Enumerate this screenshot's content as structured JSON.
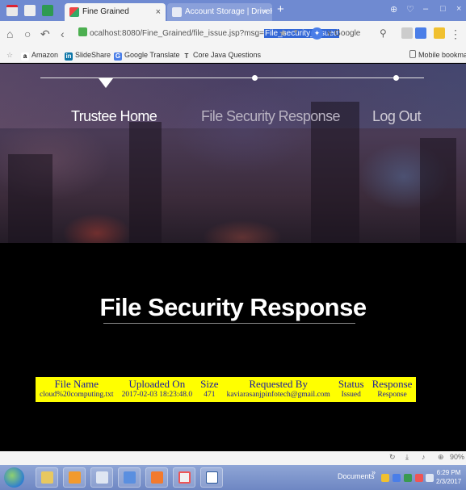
{
  "browser": {
    "tabs": [
      {
        "title": "Fine Grained",
        "close": "×"
      },
      {
        "title": "Account Storage | DriveHQ",
        "close": "×"
      }
    ],
    "new_tab": "+",
    "window_controls": [
      "⊕",
      "♡",
      "–",
      "□",
      "×"
    ],
    "url_prefix": "ocalhost:8080/Fine_Grained/file_issue.jsp?msg=",
    "url_highlight": "File_security_issued",
    "search_engine": "Google",
    "bookmarks": [
      "Amazon",
      "SlideShare",
      "Google Translate",
      "Core Java Questions"
    ],
    "mobile_bookmarks": "Mobile bookmarks",
    "colors": {
      "tabstrip": "#6f8ad1",
      "url_highlight": "#3367d6"
    }
  },
  "site_nav": {
    "items": [
      "Trustee Home",
      "File Security Response",
      "Log Out"
    ]
  },
  "page": {
    "title": "File Security Response"
  },
  "table": {
    "headers": [
      "File Name",
      "Uploaded On",
      "Size",
      "Requested By",
      "Status",
      "Response"
    ],
    "rows": [
      [
        "cloud%20computing.txt",
        "2017-02-03 18:23:48.0",
        "471",
        "kaviarasanjpinfotech@gmail.com",
        "Issued",
        "Response"
      ]
    ],
    "colors": {
      "background": "#ffff00",
      "text": "#1a1aa0"
    }
  },
  "status_bar": {
    "icons": [
      "refresh-icon",
      "download-icon",
      "sound-icon",
      "zoom-icon"
    ],
    "zoom": "90%"
  },
  "taskbar": {
    "documents_label": "Documents",
    "overflow": "»",
    "time": "6:29 PM",
    "date": "2/3/2017"
  }
}
